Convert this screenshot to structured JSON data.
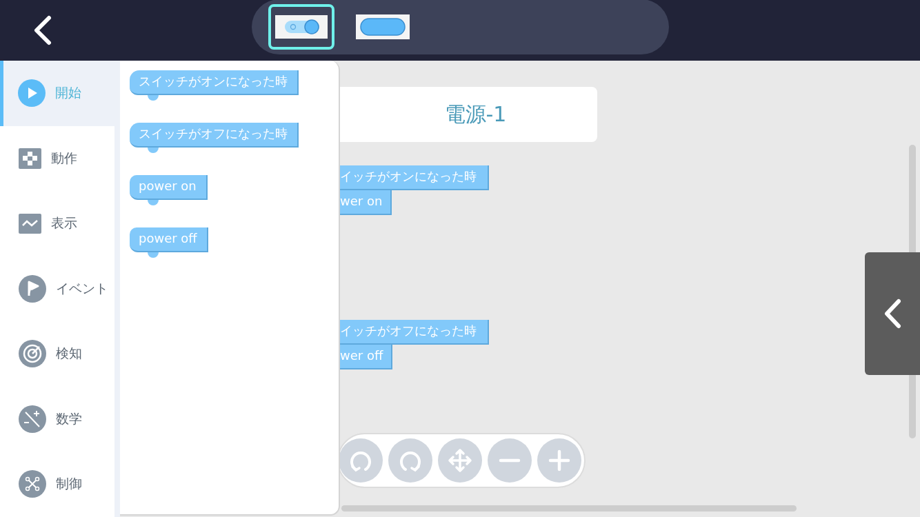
{
  "top_bar": {
    "devices": [
      {
        "kind": "toggle",
        "selected": true
      },
      {
        "kind": "button",
        "selected": false
      }
    ]
  },
  "categories": [
    {
      "label": "開始",
      "selected": true
    },
    {
      "label": "動作",
      "selected": false
    },
    {
      "label": "表示",
      "selected": false
    },
    {
      "label": "イベント",
      "selected": false
    },
    {
      "label": "検知",
      "selected": false
    },
    {
      "label": "数学",
      "selected": false
    },
    {
      "label": "制御",
      "selected": false
    }
  ],
  "palette": {
    "blocks": [
      {
        "kind": "hat",
        "text": "スイッチがオンになった時"
      },
      {
        "kind": "hat",
        "text": "スイッチがオフになった時"
      },
      {
        "kind": "command",
        "text": "power on"
      },
      {
        "kind": "command",
        "text": "power off"
      }
    ]
  },
  "workspace": {
    "title": "電源-1",
    "scripts": [
      {
        "hat": "イッチがオンになった時",
        "command": "wer on"
      },
      {
        "hat": "イッチがオフになった時",
        "command": "wer off"
      }
    ]
  }
}
